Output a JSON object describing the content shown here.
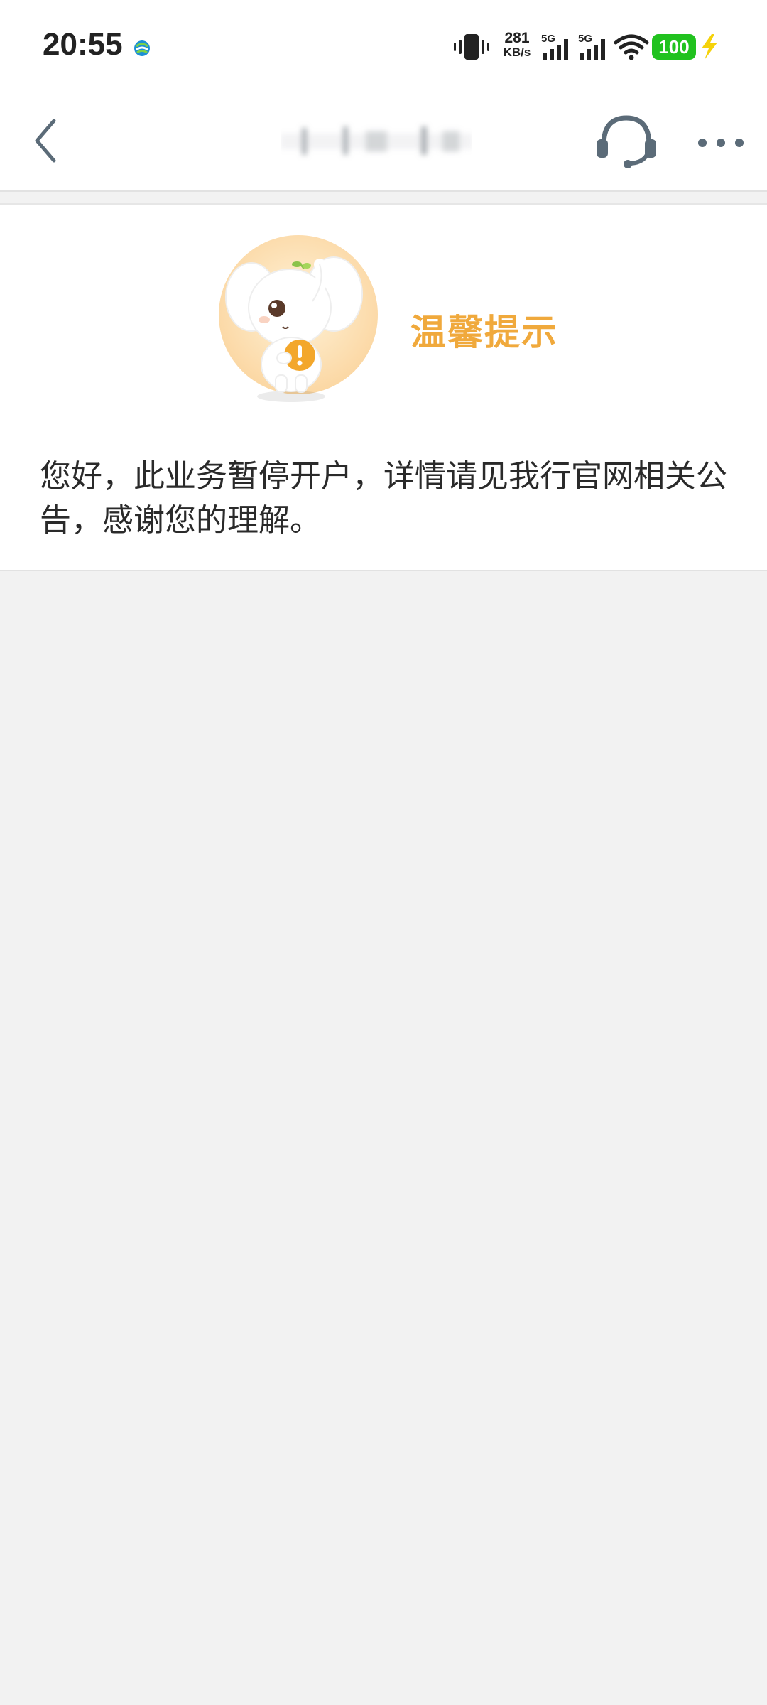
{
  "status_bar": {
    "time": "20:55",
    "carrier_icon": "china-mobile-icon",
    "net_speed_value": "281",
    "net_speed_unit": "KB/s",
    "signal_1_label": "5G",
    "signal_2_label": "5G",
    "battery_level": "100",
    "battery_color": "#21c21f",
    "charging_color": "#f5d20a"
  },
  "nav": {
    "back_icon": "chevron-left-icon",
    "title": "",
    "service_icon": "headset-icon",
    "more_icon": "more-dots-icon"
  },
  "notice": {
    "title": "温馨提示",
    "title_color": "#f0a93c",
    "message": "您好，此业务暂停开户，详情请见我行官网相关公告，感谢您的理解。",
    "mascot_icon": "elephant-mascot-icon"
  },
  "colors": {
    "background": "#f2f2f2",
    "card": "#ffffff",
    "icon_gray": "#5b6b78"
  }
}
